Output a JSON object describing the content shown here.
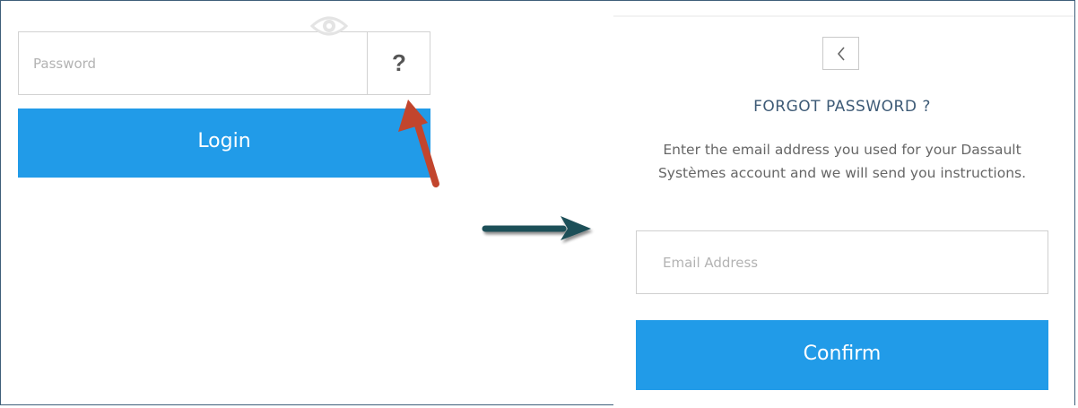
{
  "login_panel": {
    "password_placeholder": "Password",
    "help_label": "?",
    "login_label": "Login",
    "icons": [
      "eye-icon",
      "help-icon"
    ]
  },
  "annotations": {
    "red_arrow_color": "#c2452d",
    "teal_arrow_color": "#1d4f58"
  },
  "forgot_panel": {
    "title": "FORGOT PASSWORD ?",
    "description": "Enter the email address you used for your Dassault Systèmes account and we will send you instructions.",
    "email_placeholder": "Email Address",
    "confirm_label": "Confirm",
    "back_icon": "chevron-left-icon"
  },
  "colors": {
    "primary_button": "#219be8",
    "title_text": "#3d5a76",
    "frame_border": "#3f5f7a"
  }
}
